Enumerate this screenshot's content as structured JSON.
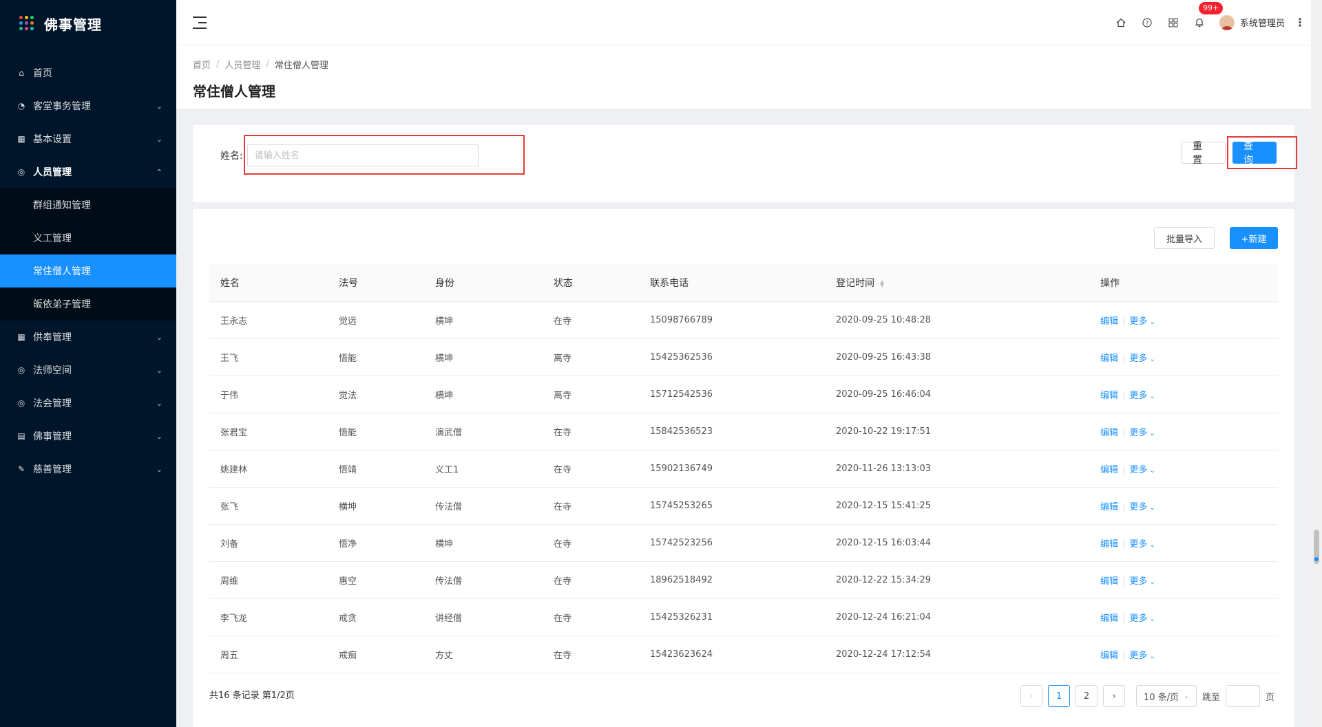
{
  "app": {
    "title": "佛事管理"
  },
  "logo_colors": [
    "#e74c3c",
    "#f1c40f",
    "#2ecc71",
    "#3498db",
    "#9b59b6",
    "#e67e22",
    "#1abc9c",
    "#e84393",
    "#00cec9"
  ],
  "sidebar": {
    "items": [
      {
        "label": "首页",
        "icon": "home-icon",
        "glyph": "⌂",
        "arrow": ""
      },
      {
        "label": "客堂事务管理",
        "icon": "dashboard-icon",
        "glyph": "◔",
        "arrow": "⌄"
      },
      {
        "label": "基本设置",
        "icon": "table-icon",
        "glyph": "▦",
        "arrow": "⌄"
      },
      {
        "label": "人员管理",
        "icon": "check-circle-icon",
        "glyph": "◎",
        "arrow": "⌃"
      },
      {
        "label": "供奉管理",
        "icon": "table-icon",
        "glyph": "▦",
        "arrow": "⌄"
      },
      {
        "label": "法师空间",
        "icon": "check-circle-icon",
        "glyph": "◎",
        "arrow": "⌄"
      },
      {
        "label": "法会管理",
        "icon": "check-circle-icon",
        "glyph": "◎",
        "arrow": "⌄"
      },
      {
        "label": "佛事管理",
        "icon": "profile-icon",
        "glyph": "▤",
        "arrow": "⌄"
      },
      {
        "label": "慈善管理",
        "icon": "form-icon",
        "glyph": "✎",
        "arrow": "⌄"
      }
    ],
    "submenu": [
      {
        "label": "群组通知管理"
      },
      {
        "label": "义工管理"
      },
      {
        "label": "常住僧人管理",
        "active": true
      },
      {
        "label": "皈依弟子管理"
      }
    ]
  },
  "header": {
    "notification_badge": "99+",
    "user_name": "系统管理员"
  },
  "breadcrumb": [
    "首页",
    "人员管理",
    "常住僧人管理"
  ],
  "page_title": "常住僧人管理",
  "search": {
    "label": "姓名:",
    "placeholder": "请输入姓名",
    "value": "",
    "reset_label": "重置",
    "query_label": "查询"
  },
  "toolbar": {
    "import_label": "批量导入",
    "new_label": "+新建"
  },
  "table": {
    "columns": [
      "姓名",
      "法号",
      "身份",
      "状态",
      "联系电话",
      "登记时间",
      "操作"
    ],
    "edit_label": "编辑",
    "more_label": "更多",
    "rows": [
      [
        "王永志",
        "觉远",
        "横坤",
        "在寺",
        "15098766789",
        "2020-09-25 10:48:28"
      ],
      [
        "王飞",
        "悟能",
        "横坤",
        "离寺",
        "15425362536",
        "2020-09-25 16:43:38"
      ],
      [
        "于伟",
        "觉法",
        "横坤",
        "离寺",
        "15712542536",
        "2020-09-25 16:46:04"
      ],
      [
        "张君宝",
        "悟能",
        "演武僧",
        "在寺",
        "15842536523",
        "2020-10-22 19:17:51"
      ],
      [
        "姚建林",
        "悟靖",
        "义工1",
        "在寺",
        "15902136749",
        "2020-11-26 13:13:03"
      ],
      [
        "张飞",
        "横坤",
        "传法僧",
        "在寺",
        "15745253265",
        "2020-12-15 15:41:25"
      ],
      [
        "刘备",
        "悟净",
        "横坤",
        "在寺",
        "15742523256",
        "2020-12-15 16:03:44"
      ],
      [
        "周维",
        "惠空",
        "传法僧",
        "在寺",
        "18962518492",
        "2020-12-22 15:34:29"
      ],
      [
        "李飞龙",
        "戒贪",
        "讲经僧",
        "在寺",
        "15425326231",
        "2020-12-24 16:21:04"
      ],
      [
        "周五",
        "戒痴",
        "方丈",
        "在寺",
        "15423623624",
        "2020-12-24 17:12:54"
      ]
    ]
  },
  "pagination": {
    "summary": "共16 条记录 第1/2页",
    "prev": "‹",
    "next": "›",
    "pages": [
      "1",
      "2"
    ],
    "current": "1",
    "page_size": "10 条/页",
    "jump_label": "跳至",
    "jump_value": "",
    "page_unit": "页"
  }
}
